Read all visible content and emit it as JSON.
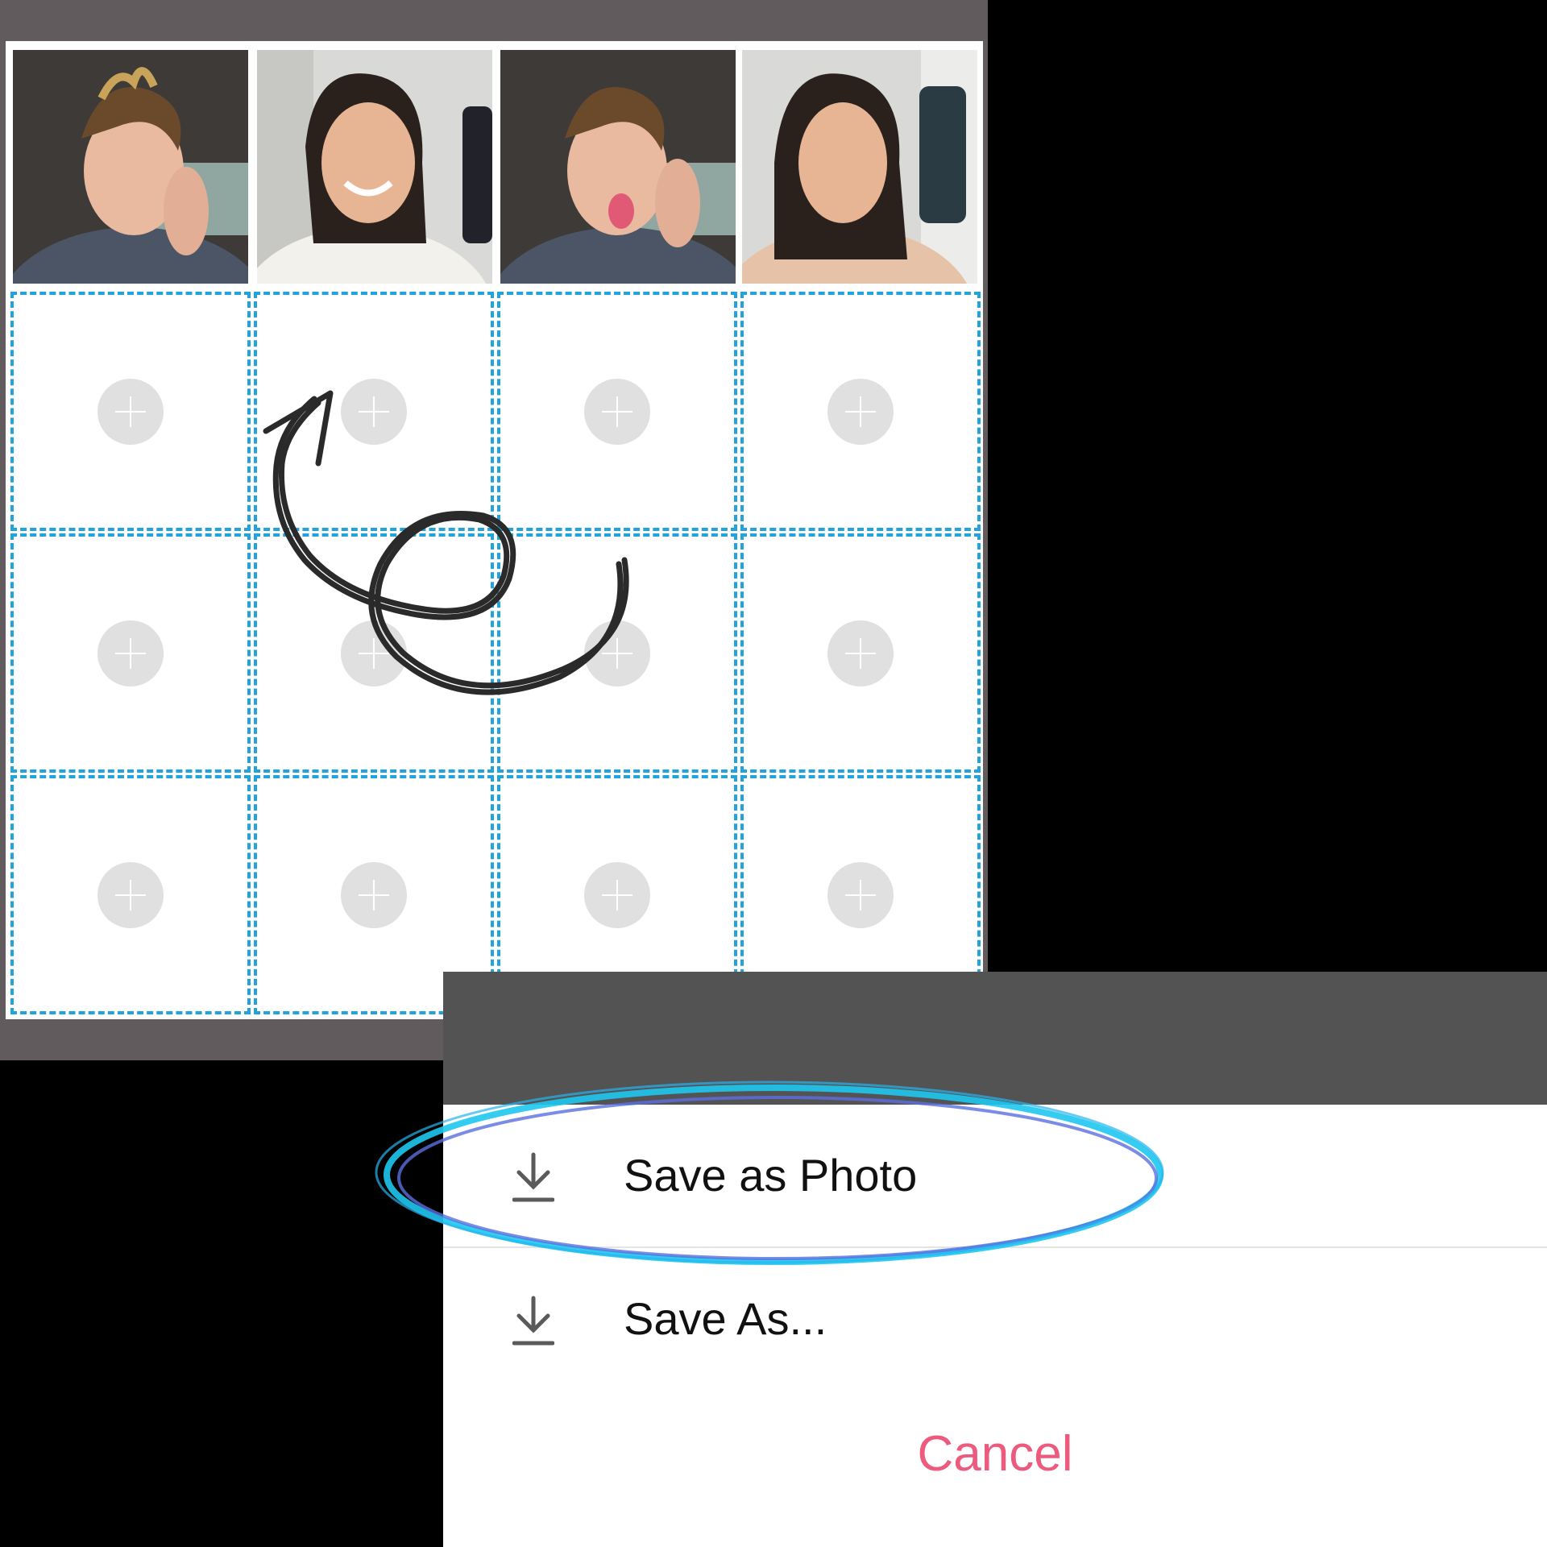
{
  "grid": {
    "columns": 4,
    "rows": 4,
    "filled_photos": [
      "photo-1",
      "photo-2",
      "photo-3",
      "photo-4"
    ],
    "empty_slot_icon": "plus-icon",
    "accent_color": "#22a3dc"
  },
  "annotation": {
    "arrow": "curly-arrow-doodle",
    "highlight": "blue-circle-highlight"
  },
  "sheet": {
    "save_photo_label": "Save as Photo",
    "save_as_label": "Save As...",
    "cancel_label": "Cancel",
    "icon": "download-icon",
    "cancel_color": "#ec5b7e"
  }
}
